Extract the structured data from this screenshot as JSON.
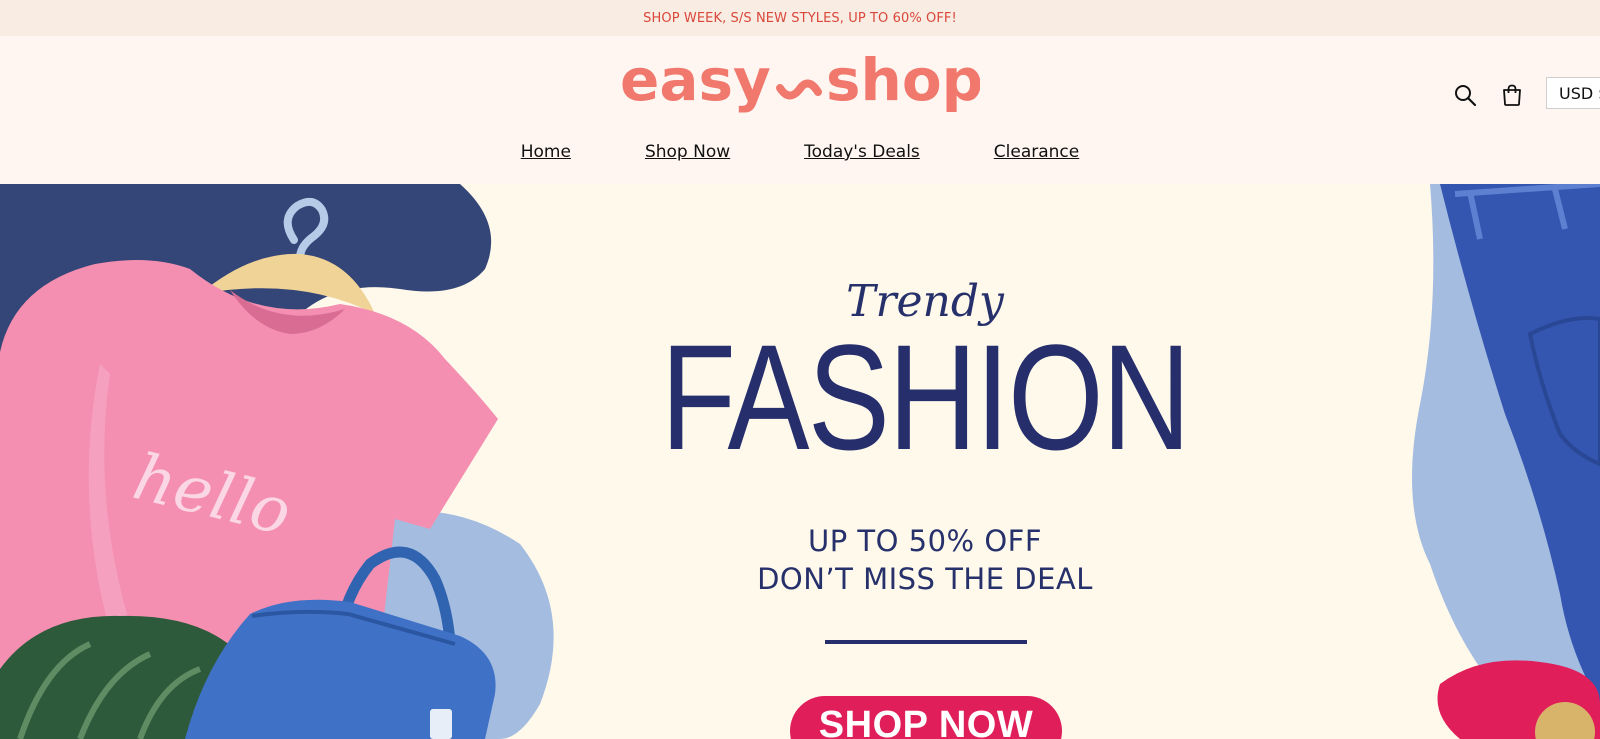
{
  "announcement": {
    "text": "SHOP WEEK, S/S NEW STYLES, UP TO 60% OFF!"
  },
  "header": {
    "logo": {
      "left": "easy",
      "right": "shop",
      "color": "#f0786c"
    },
    "icons": {
      "search": "search-icon",
      "cart": "cart-icon"
    },
    "currency": "USD $"
  },
  "nav": {
    "items": [
      {
        "label": "Home"
      },
      {
        "label": "Shop Now"
      },
      {
        "label": "Today's Deals"
      },
      {
        "label": "Clearance"
      }
    ]
  },
  "hero": {
    "kicker": "Trendy",
    "headline": "FASHION",
    "offer_line1": "UP TO 50% OFF",
    "offer_line2": "DON’T MISS THE DEAL",
    "cta_label": "SHOP NOW",
    "shirt_print": "hello",
    "colors": {
      "navy": "#262f6c",
      "pink": "#f48fb1",
      "cta": "#e01f5a",
      "background": "#fef9eb"
    }
  }
}
